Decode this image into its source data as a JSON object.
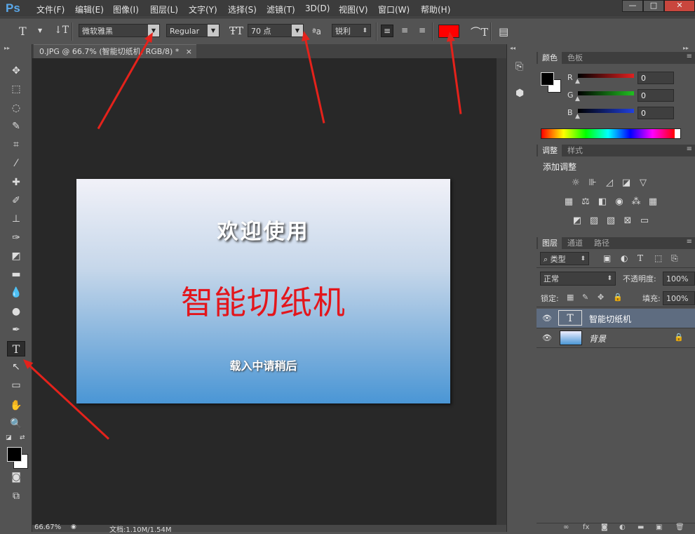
{
  "app": {
    "logo": "Ps"
  },
  "menu": [
    "文件(F)",
    "编辑(E)",
    "图像(I)",
    "图层(L)",
    "文字(Y)",
    "选择(S)",
    "滤镜(T)",
    "3D(D)",
    "视图(V)",
    "窗口(W)",
    "帮助(H)"
  ],
  "window_controls": [
    "—",
    "□",
    "✕"
  ],
  "options": {
    "tool_icon": "T",
    "font_family": "微软雅黑",
    "font_style": "Regular",
    "font_size": "70 点",
    "aa_icon": "ªa",
    "antialias": "锐利",
    "text_color": "#ff0000"
  },
  "document": {
    "tab_title": "0.JPG @ 66.7% (智能切纸机, RGB/8) *",
    "tab_close": "×",
    "canvas_texts": {
      "welcome": "欢迎使用",
      "title": "智能切纸机",
      "loading": "载入中请稍后"
    },
    "title_color": "#e3161c"
  },
  "status": {
    "zoom": "66.67%",
    "doc_info": "文档:1.10M/1.54M"
  },
  "panels": {
    "color_tabs": [
      "颜色",
      "色板"
    ],
    "rgb": [
      {
        "label": "R",
        "value": "0",
        "color": "#e02020"
      },
      {
        "label": "G",
        "value": "0",
        "color": "#20c020"
      },
      {
        "label": "B",
        "value": "0",
        "color": "#2040e0"
      }
    ],
    "adjust_tabs": [
      "调整",
      "样式"
    ],
    "adjust_title": "添加调整",
    "layers_tabs": [
      "图层",
      "通道",
      "路径"
    ],
    "filter_kind": "类型",
    "blend_mode": "正常",
    "opacity_label": "不透明度:",
    "opacity": "100%",
    "lock_label": "锁定:",
    "fill_label": "填充:",
    "fill": "100%",
    "layers": [
      {
        "name": "智能切纸机",
        "type": "text",
        "selected": true
      },
      {
        "name": "背景",
        "type": "image",
        "locked": true
      }
    ]
  }
}
